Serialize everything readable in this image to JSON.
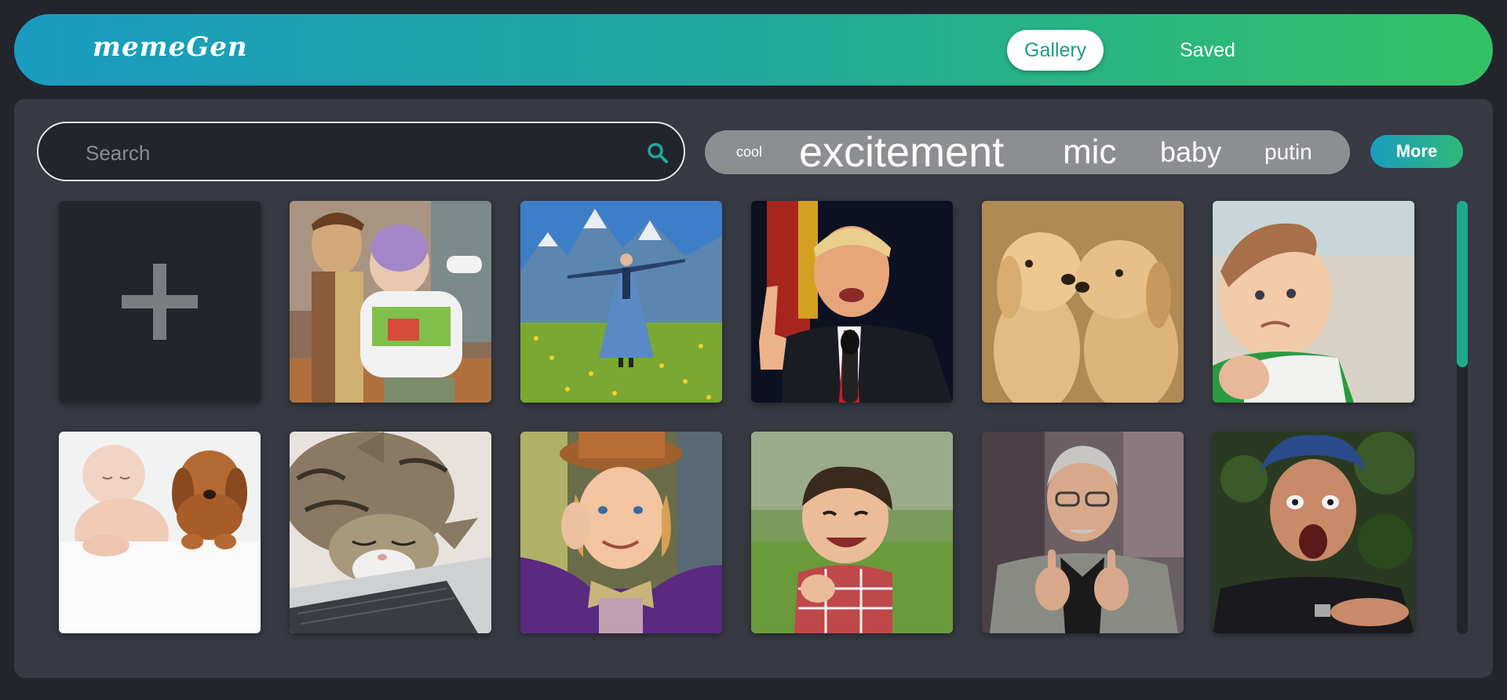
{
  "app": {
    "logo": "memeGen"
  },
  "nav": {
    "gallery": "Gallery",
    "saved": "Saved"
  },
  "search": {
    "placeholder": "Search"
  },
  "tags": [
    "cool",
    "excitement",
    "mic",
    "baby",
    "putin"
  ],
  "more_button": "More",
  "colors": {
    "accent_start": "#1a9cc0",
    "accent_end": "#34c064",
    "panel": "#373a43",
    "background": "#23252d"
  },
  "gallery": {
    "add_tile_icon": "plus-icon",
    "memes": [
      "toy-story-image",
      "mountain-meadow-image",
      "podium-speaker-image",
      "puppies-image",
      "success-kid-image",
      "baby-and-puppy-image",
      "sleeping-cat-laptop-image",
      "condescending-wonka-image",
      "evil-toddler-image",
      "pointing-man-image",
      "shocked-man-image"
    ]
  }
}
